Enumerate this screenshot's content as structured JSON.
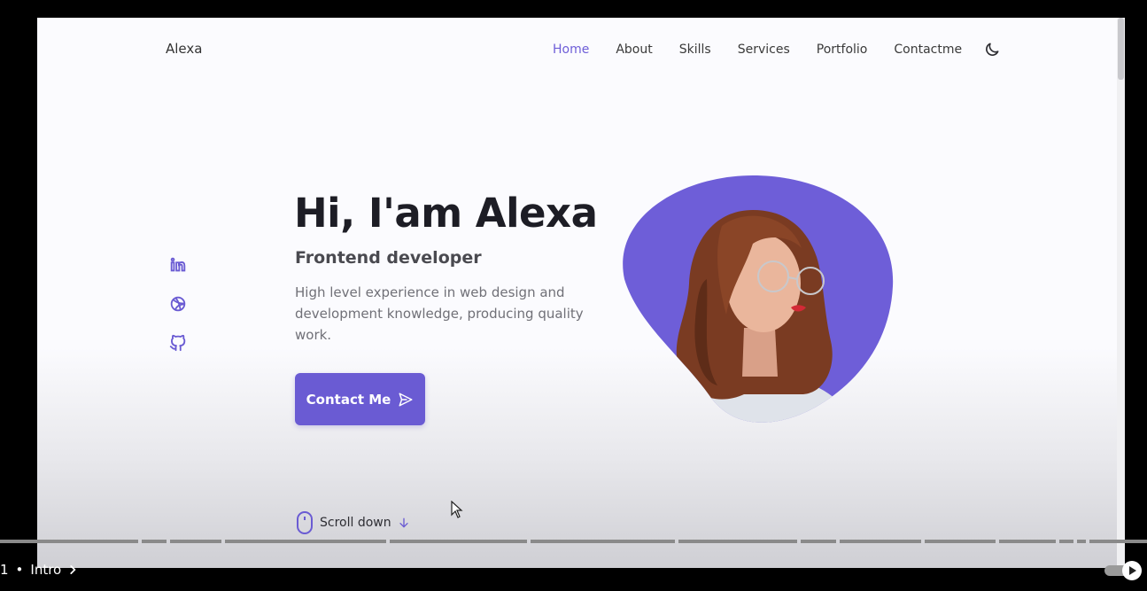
{
  "brand": "Alexa",
  "nav": {
    "items": [
      "Home",
      "About",
      "Skills",
      "Services",
      "Portfolio",
      "Contactme"
    ],
    "active": "Home",
    "theme_icon": "moon-icon"
  },
  "socials": [
    "linkedin-icon",
    "dribbble-icon",
    "github-icon"
  ],
  "hero": {
    "title": "Hi, I'am Alexa",
    "subtitle": "Frontend developer",
    "description": "High level experience in web design and development knowledge, producing quality work.",
    "button_label": "Contact Me"
  },
  "scroll": {
    "label": "Scroll down"
  },
  "player": {
    "chapter_number": "1",
    "chapter_title": "Intro"
  },
  "colors": {
    "accent": "#6a5bd3",
    "blob": "#6e5ed8",
    "text_dark": "#1d1d25"
  }
}
